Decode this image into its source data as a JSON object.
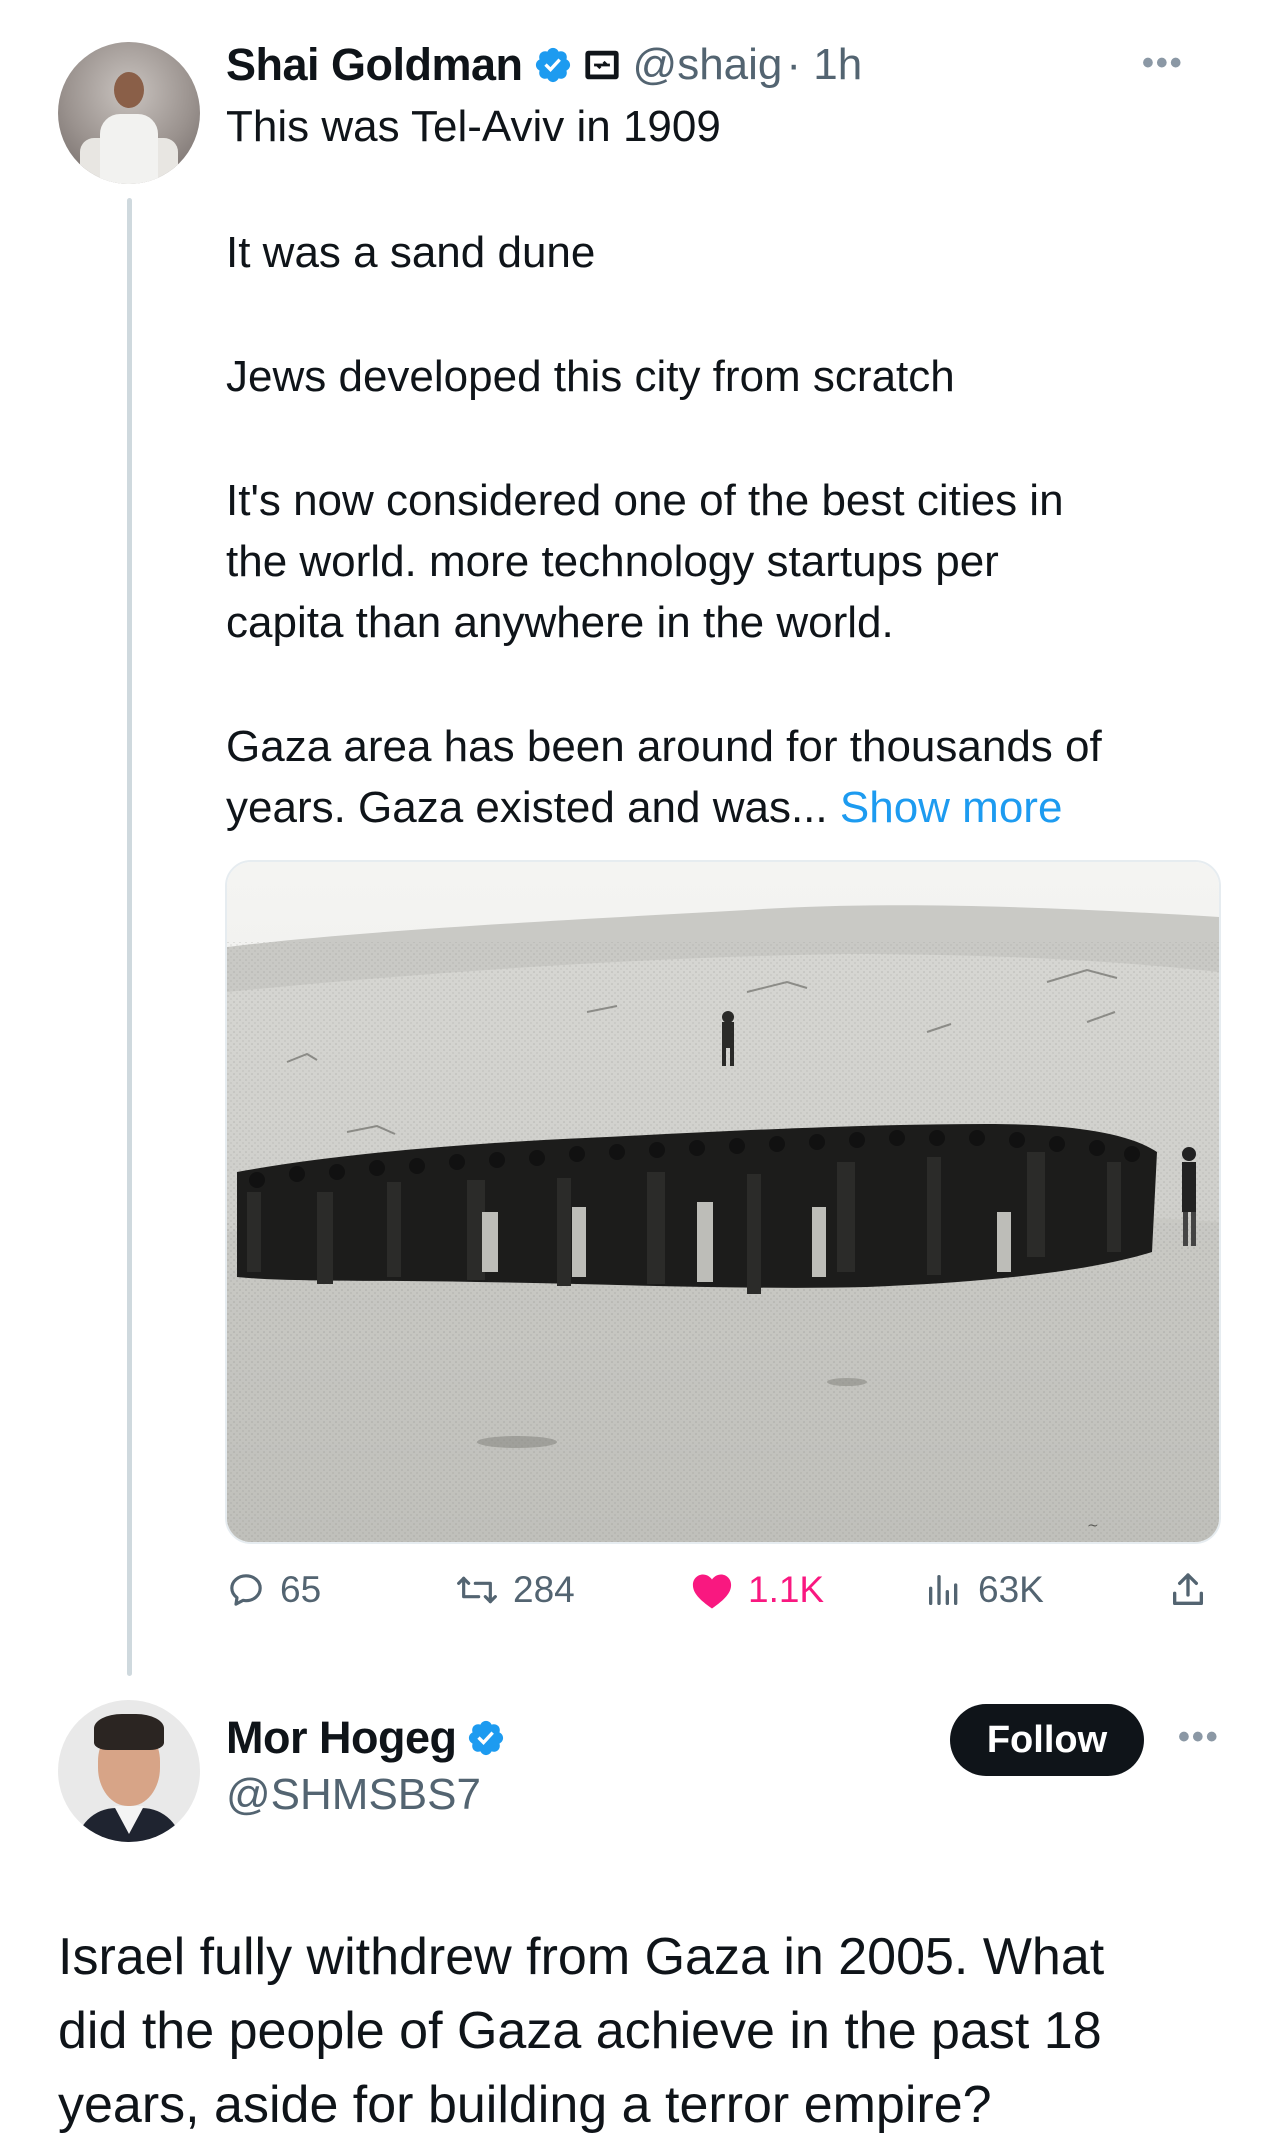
{
  "tweet": {
    "author": {
      "name": "Shai Goldman",
      "handle": "@shaig",
      "time": "· 1h",
      "verified": true,
      "affiliation_icon": "affiliate-badge-icon"
    },
    "more_label": "•••",
    "text": {
      "p1": "This was Tel-Aviv in 1909",
      "p2": "It was a sand dune",
      "p3": "Jews developed this city from scratch",
      "p4_l1": "It's now considered one of the best cities in",
      "p4_l2": "the world.  more technology startups per",
      "p4_l3": "capita than anywhere in the world.",
      "p5_l1": "Gaza area has been around for thousands of",
      "p5_l2": "years.  Gaza existed and was...",
      "show_more": "Show more"
    },
    "media": {
      "type": "photo",
      "description_icon": "black-and-white-photo-crowd-on-sand-dune"
    },
    "actions": {
      "replies": "65",
      "retweets": "284",
      "likes": "1.1K",
      "views": "63K"
    }
  },
  "reply": {
    "author": {
      "name": "Mor Hogeg",
      "handle": "@SHMSBS7",
      "verified": true
    },
    "follow_label": "Follow",
    "more_label": "•••",
    "text_l1": "Israel fully withdrew from Gaza in 2005. What",
    "text_l2": "did the people of Gaza achieve in the past 18",
    "text_l3": "years, aside for building a terror empire?"
  },
  "colors": {
    "accent": "#1d9bf0",
    "like": "#f91880",
    "text": "#0f1419",
    "secondary": "#536471",
    "thread_line": "#cfd9de"
  }
}
